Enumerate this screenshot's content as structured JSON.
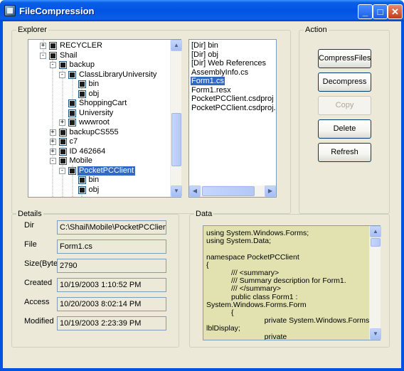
{
  "window": {
    "title": "FileCompression"
  },
  "explorer": {
    "label": "Explorer",
    "tree": [
      {
        "label": "RECYCLER",
        "expander": "+"
      },
      {
        "label": "Shail",
        "expander": "-"
      },
      {
        "label": "backup",
        "expander": "-"
      },
      {
        "label": "ClassLibraryUniversity",
        "expander": "-"
      },
      {
        "label": "bin",
        "expander": ""
      },
      {
        "label": "obj",
        "expander": ""
      },
      {
        "label": "ShoppingCart",
        "expander": ""
      },
      {
        "label": "University",
        "expander": ""
      },
      {
        "label": "wwwroot",
        "expander": "+"
      },
      {
        "label": "backupCS555",
        "expander": "+"
      },
      {
        "label": "c7",
        "expander": "+"
      },
      {
        "label": "ID 462664",
        "expander": "+"
      },
      {
        "label": "Mobile",
        "expander": "-"
      },
      {
        "label": "PocketPCClient",
        "expander": "-"
      },
      {
        "label": "bin",
        "expander": ""
      },
      {
        "label": "obj",
        "expander": ""
      }
    ],
    "files": [
      "[Dir] bin",
      "[Dir] obj",
      "[Dir] Web References",
      "AssemblyInfo.cs",
      "Form1.cs",
      "Form1.resx",
      "PocketPCClient.csdproj",
      "PocketPCClient.csdproj.user"
    ],
    "selected_file": "Form1.cs"
  },
  "action": {
    "label": "Action",
    "compress": "CompressFiles",
    "decompress": "Decompress",
    "copy": "Copy",
    "delete": "Delete",
    "refresh": "Refresh"
  },
  "details": {
    "label": "Details",
    "dir_label": "Dir",
    "dir_value": "C:\\Shail\\Mobile\\PocketPCClient",
    "file_label": "File",
    "file_value": "Form1.cs",
    "size_label": "Size(Byte)",
    "size_value": "2790",
    "created_label": "Created",
    "created_value": "10/19/2003 1:10:52 PM",
    "access_label": "Access",
    "access_value": "10/20/2003 8:02:14 PM",
    "modified_label": "Modified",
    "modified_value": "10/19/2003 2:23:39 PM"
  },
  "data": {
    "label": "Data",
    "lines": [
      "using System.Windows.Forms;",
      "using System.Data;",
      "",
      "namespace PocketPCClient",
      "{",
      "            /// <summary>",
      "            /// Summary description for Form1.",
      "            /// </summary>",
      "            public class Form1 :",
      "System.Windows.Forms.Form",
      "            {",
      "                            private System.Windows.Forms.Label",
      "lblDisplay;",
      "                            private"
    ]
  },
  "colors": {
    "title_bar": "#0054e3",
    "selection": "#316ac5",
    "data_background": "#e1e2b0",
    "client": "#ece9d8"
  }
}
